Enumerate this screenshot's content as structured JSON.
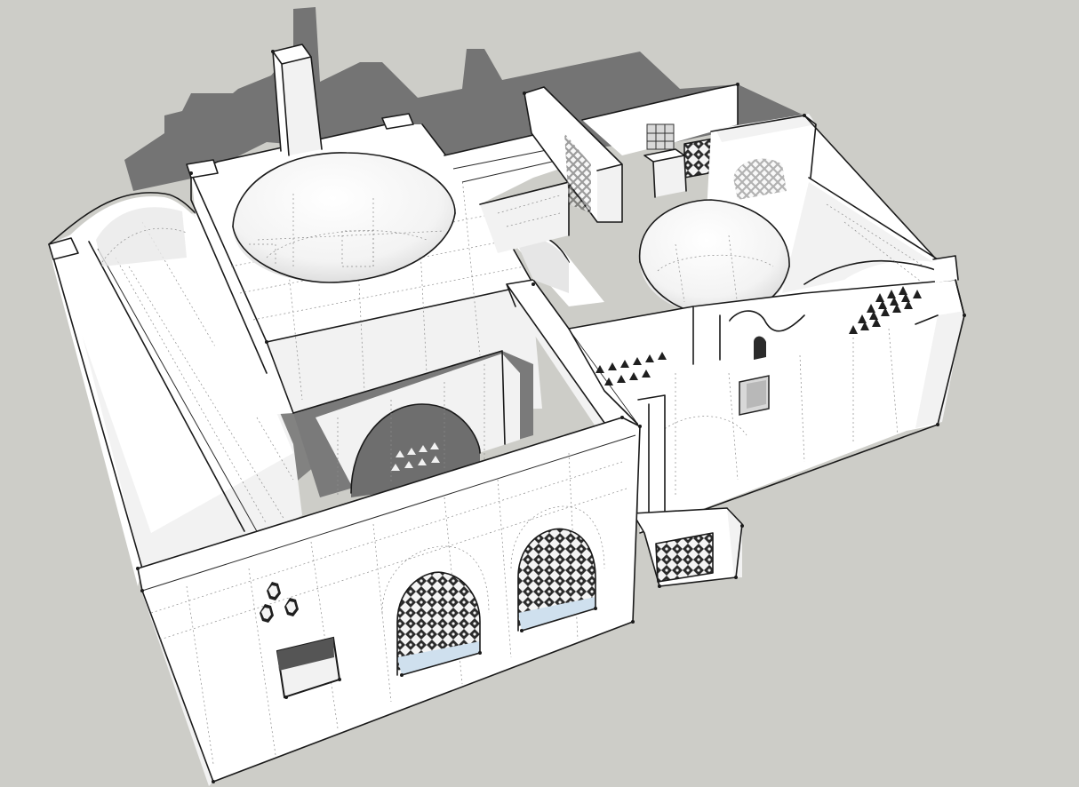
{
  "scene": {
    "background_color": "#cdcdc8",
    "shadow_color": "#747474",
    "model_face_color": "#ffffff",
    "edge_color": "#1a1a1a",
    "hidden_line_color": "#8a8a8a"
  },
  "model": {
    "elements": [
      {
        "name": "large-dome"
      },
      {
        "name": "small-dome"
      },
      {
        "name": "chimney"
      },
      {
        "name": "vaulted-roof-left"
      },
      {
        "name": "vaulted-roof-right"
      },
      {
        "name": "arched-window-lattice-left"
      },
      {
        "name": "arched-window-lattice-right"
      },
      {
        "name": "courtyard-arch"
      },
      {
        "name": "triangular-vents-left"
      },
      {
        "name": "triangular-vents-right"
      },
      {
        "name": "balcony-lattice"
      },
      {
        "name": "front-window"
      }
    ]
  }
}
